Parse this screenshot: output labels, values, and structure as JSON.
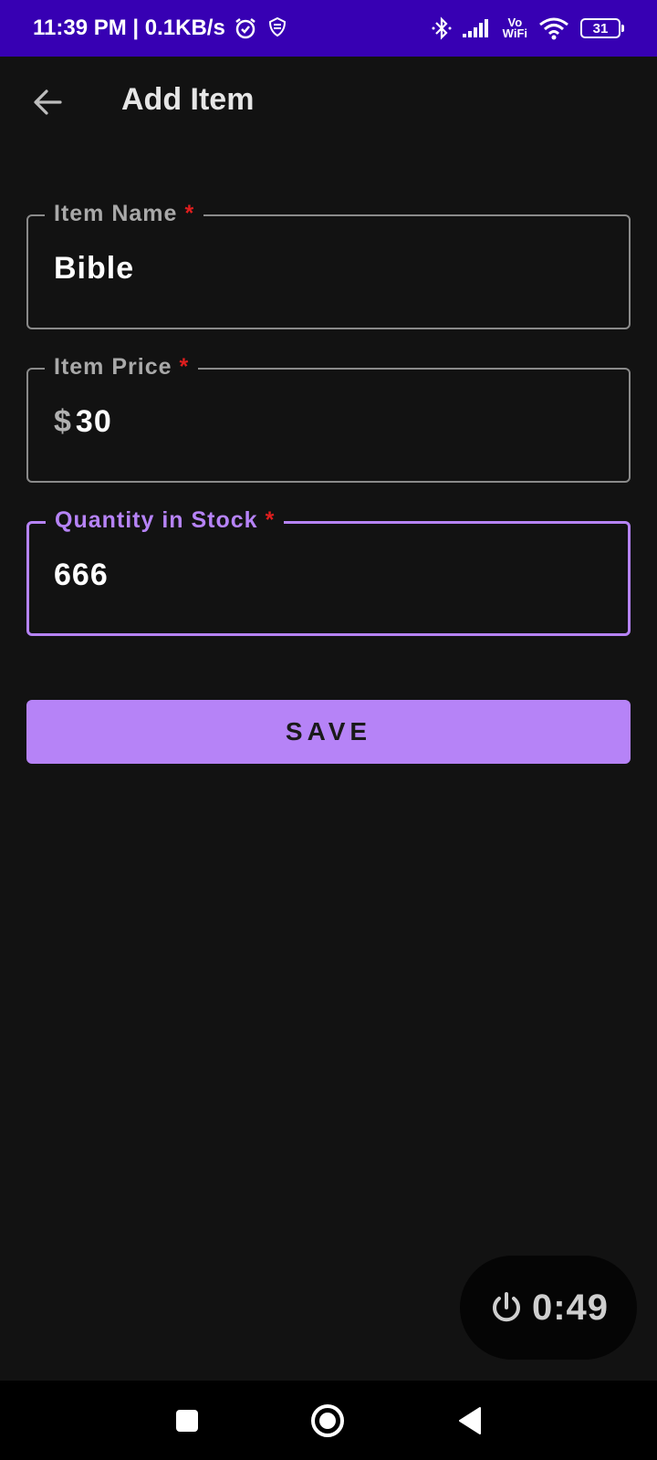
{
  "status_bar": {
    "time_speed": "11:39 PM | 0.1KB/s",
    "vowifi_top": "Vo",
    "vowifi_bottom": "WiFi",
    "battery_level": "31"
  },
  "app_bar": {
    "title": "Add Item"
  },
  "form": {
    "item_name": {
      "label": "Item Name",
      "required_mark": "*",
      "value": "Bible"
    },
    "item_price": {
      "label": "Item Price",
      "required_mark": "*",
      "prefix": "$",
      "value": "30"
    },
    "quantity": {
      "label": "Quantity in Stock",
      "required_mark": "*",
      "value": "666"
    }
  },
  "save_label": "SAVE",
  "timer": {
    "value": "0:49"
  },
  "colors": {
    "status_bar": "#3700b3",
    "background": "#121212",
    "accent": "#b683f7",
    "required": "#e01e1e"
  },
  "icons": {
    "back": "arrow-back-icon",
    "alarm": "alarm-icon",
    "bluetooth": "bluetooth-icon",
    "signal": "signal-icon",
    "wifi": "wifi-icon",
    "power": "power-icon",
    "nav_recents": "square-icon",
    "nav_home": "circle-icon",
    "nav_back": "triangle-back-icon"
  }
}
